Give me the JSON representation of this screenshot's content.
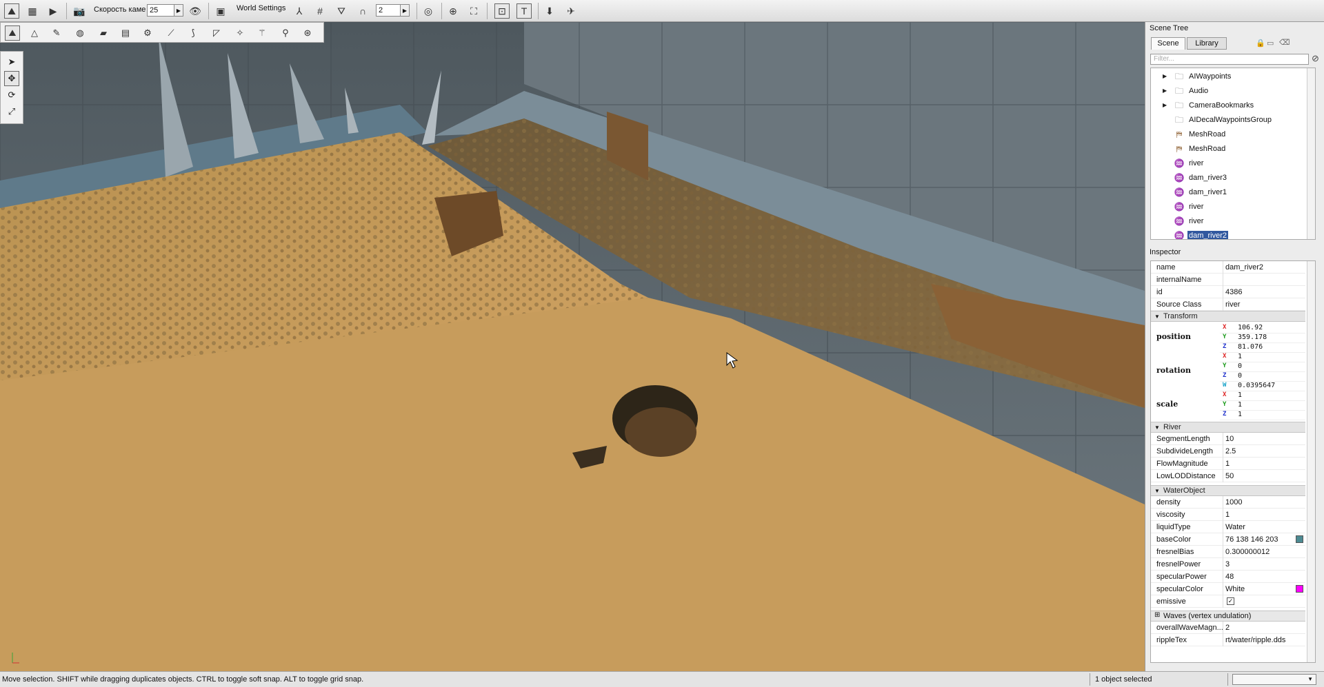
{
  "toolbar": {
    "camera_speed_label": "Скорость каме",
    "camera_speed_value": "25",
    "world_settings_label": "World Settings",
    "grid_value": "2"
  },
  "scene_tree": {
    "title": "Scene Tree",
    "tabs": [
      "Scene",
      "Library"
    ],
    "filter_placeholder": "Filter...",
    "items": [
      {
        "label": "AIWaypoints",
        "icon": "folder-icon",
        "expandable": true
      },
      {
        "label": "Audio",
        "icon": "folder-icon",
        "expandable": true
      },
      {
        "label": "CameraBookmarks",
        "icon": "folder-icon",
        "expandable": true
      },
      {
        "label": "AIDecalWaypointsGroup",
        "icon": "folder-icon",
        "expandable": false
      },
      {
        "label": "MeshRoad",
        "icon": "meshroad-icon",
        "expandable": false
      },
      {
        "label": "MeshRoad",
        "icon": "meshroad-icon",
        "expandable": false
      },
      {
        "label": "river",
        "icon": "river-icon",
        "expandable": false
      },
      {
        "label": "dam_river3",
        "icon": "river-icon",
        "expandable": false
      },
      {
        "label": "dam_river1",
        "icon": "river-icon",
        "expandable": false
      },
      {
        "label": "river",
        "icon": "river-icon",
        "expandable": false
      },
      {
        "label": "river",
        "icon": "river-icon",
        "expandable": false
      },
      {
        "label": "dam_river2",
        "icon": "river-icon",
        "expandable": false,
        "selected": true
      }
    ]
  },
  "inspector": {
    "title": "Inspector",
    "general": [
      {
        "key": "name",
        "value": "dam_river2"
      },
      {
        "key": "internalName",
        "value": ""
      },
      {
        "key": "id",
        "value": "4386"
      },
      {
        "key": "Source Class",
        "value": "river"
      }
    ],
    "transform_label": "Transform",
    "position_label": "position",
    "position": [
      {
        "axis": "X",
        "value": "106.92"
      },
      {
        "axis": "Y",
        "value": "359.178"
      },
      {
        "axis": "Z",
        "value": "81.076"
      }
    ],
    "rotation_label": "rotation",
    "rotation": [
      {
        "axis": "X",
        "value": "1"
      },
      {
        "axis": "Y",
        "value": "0"
      },
      {
        "axis": "Z",
        "value": "0"
      },
      {
        "axis": "W",
        "value": "0.0395647"
      }
    ],
    "scale_label": "scale",
    "scale": [
      {
        "axis": "X",
        "value": "1"
      },
      {
        "axis": "Y",
        "value": "1"
      },
      {
        "axis": "Z",
        "value": "1"
      }
    ],
    "river_label": "River",
    "river": [
      {
        "key": "SegmentLength",
        "value": "10"
      },
      {
        "key": "SubdivideLength",
        "value": "2.5"
      },
      {
        "key": "FlowMagnitude",
        "value": "1"
      },
      {
        "key": "LowLODDistance",
        "value": "50"
      }
    ],
    "water_label": "WaterObject",
    "water": [
      {
        "key": "density",
        "value": "1000"
      },
      {
        "key": "viscosity",
        "value": "1"
      },
      {
        "key": "liquidType",
        "value": "Water"
      },
      {
        "key": "baseColor",
        "value": "76 138 146 203",
        "swatch": "#4c8a92"
      },
      {
        "key": "fresnelBias",
        "value": "0.300000012"
      },
      {
        "key": "fresnelPower",
        "value": "3"
      },
      {
        "key": "specularPower",
        "value": "48"
      },
      {
        "key": "specularColor",
        "value": "White",
        "swatch": "#ff00ff"
      },
      {
        "key": "emissive",
        "value": "",
        "checkbox": true
      }
    ],
    "waves_label": "Waves (vertex undulation)",
    "waves": [
      {
        "key": "overallWaveMagn...",
        "value": "2"
      },
      {
        "key": "rippleTex",
        "value": "rt/water/ripple.dds"
      }
    ]
  },
  "status": {
    "message": "Move selection.  SHIFT while dragging duplicates objects.  CTRL to toggle soft snap.  ALT to toggle grid snap.",
    "selection": "1 object selected"
  },
  "colors": {
    "selection": "#31589f",
    "sand": "#c59a55",
    "wall": "#5f6a70"
  }
}
